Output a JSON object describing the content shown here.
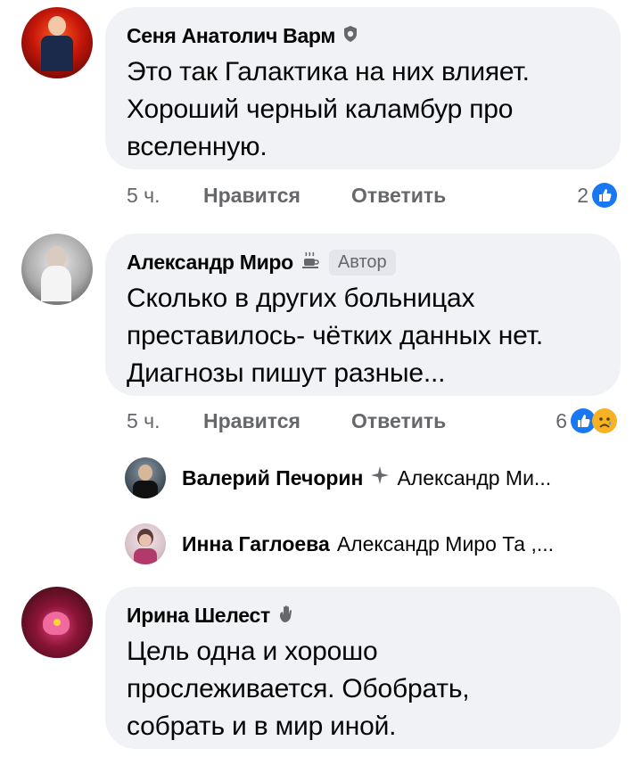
{
  "comments": [
    {
      "author": "Сеня Анатолич Варм",
      "badge_icon": "shield-icon",
      "lines": [
        "Это так Галактика на них влияет.",
        "Хороший черный каламбур про",
        "вселенную."
      ],
      "time": "5 ч.",
      "like_label": "Нравится",
      "reply_label": "Ответить",
      "reaction_count": "2",
      "reactions": [
        "like"
      ]
    },
    {
      "author": "Александр Миро",
      "badge_icon": "coffee-cup-icon",
      "author_tag": "Автор",
      "lines": [
        "Сколько в других больницах",
        "преставилось- чётких данных нет.",
        "Диагнозы пишут разные..."
      ],
      "time": "5 ч.",
      "like_label": "Нравится",
      "reply_label": "Ответить",
      "reaction_count": "6",
      "reactions": [
        "like",
        "sad"
      ]
    },
    {
      "author": "Ирина Шелест",
      "badge_icon": "waving-hand-icon",
      "lines": [
        "Цель одна и хорошо",
        "прослеживается. Обобрать,",
        "собрать и в мир иной."
      ]
    }
  ],
  "replies": [
    {
      "author": "Валерий Печорин",
      "badge_icon": "sparkle-icon",
      "text": "Александр Ми..."
    },
    {
      "author": "Инна Гаглоева",
      "text": "Александр Миро Та ,..."
    }
  ],
  "colors": {
    "accent": "#1877f2",
    "bubble": "#f0f2f5",
    "meta": "#65676b",
    "sad": "#f7b125"
  }
}
